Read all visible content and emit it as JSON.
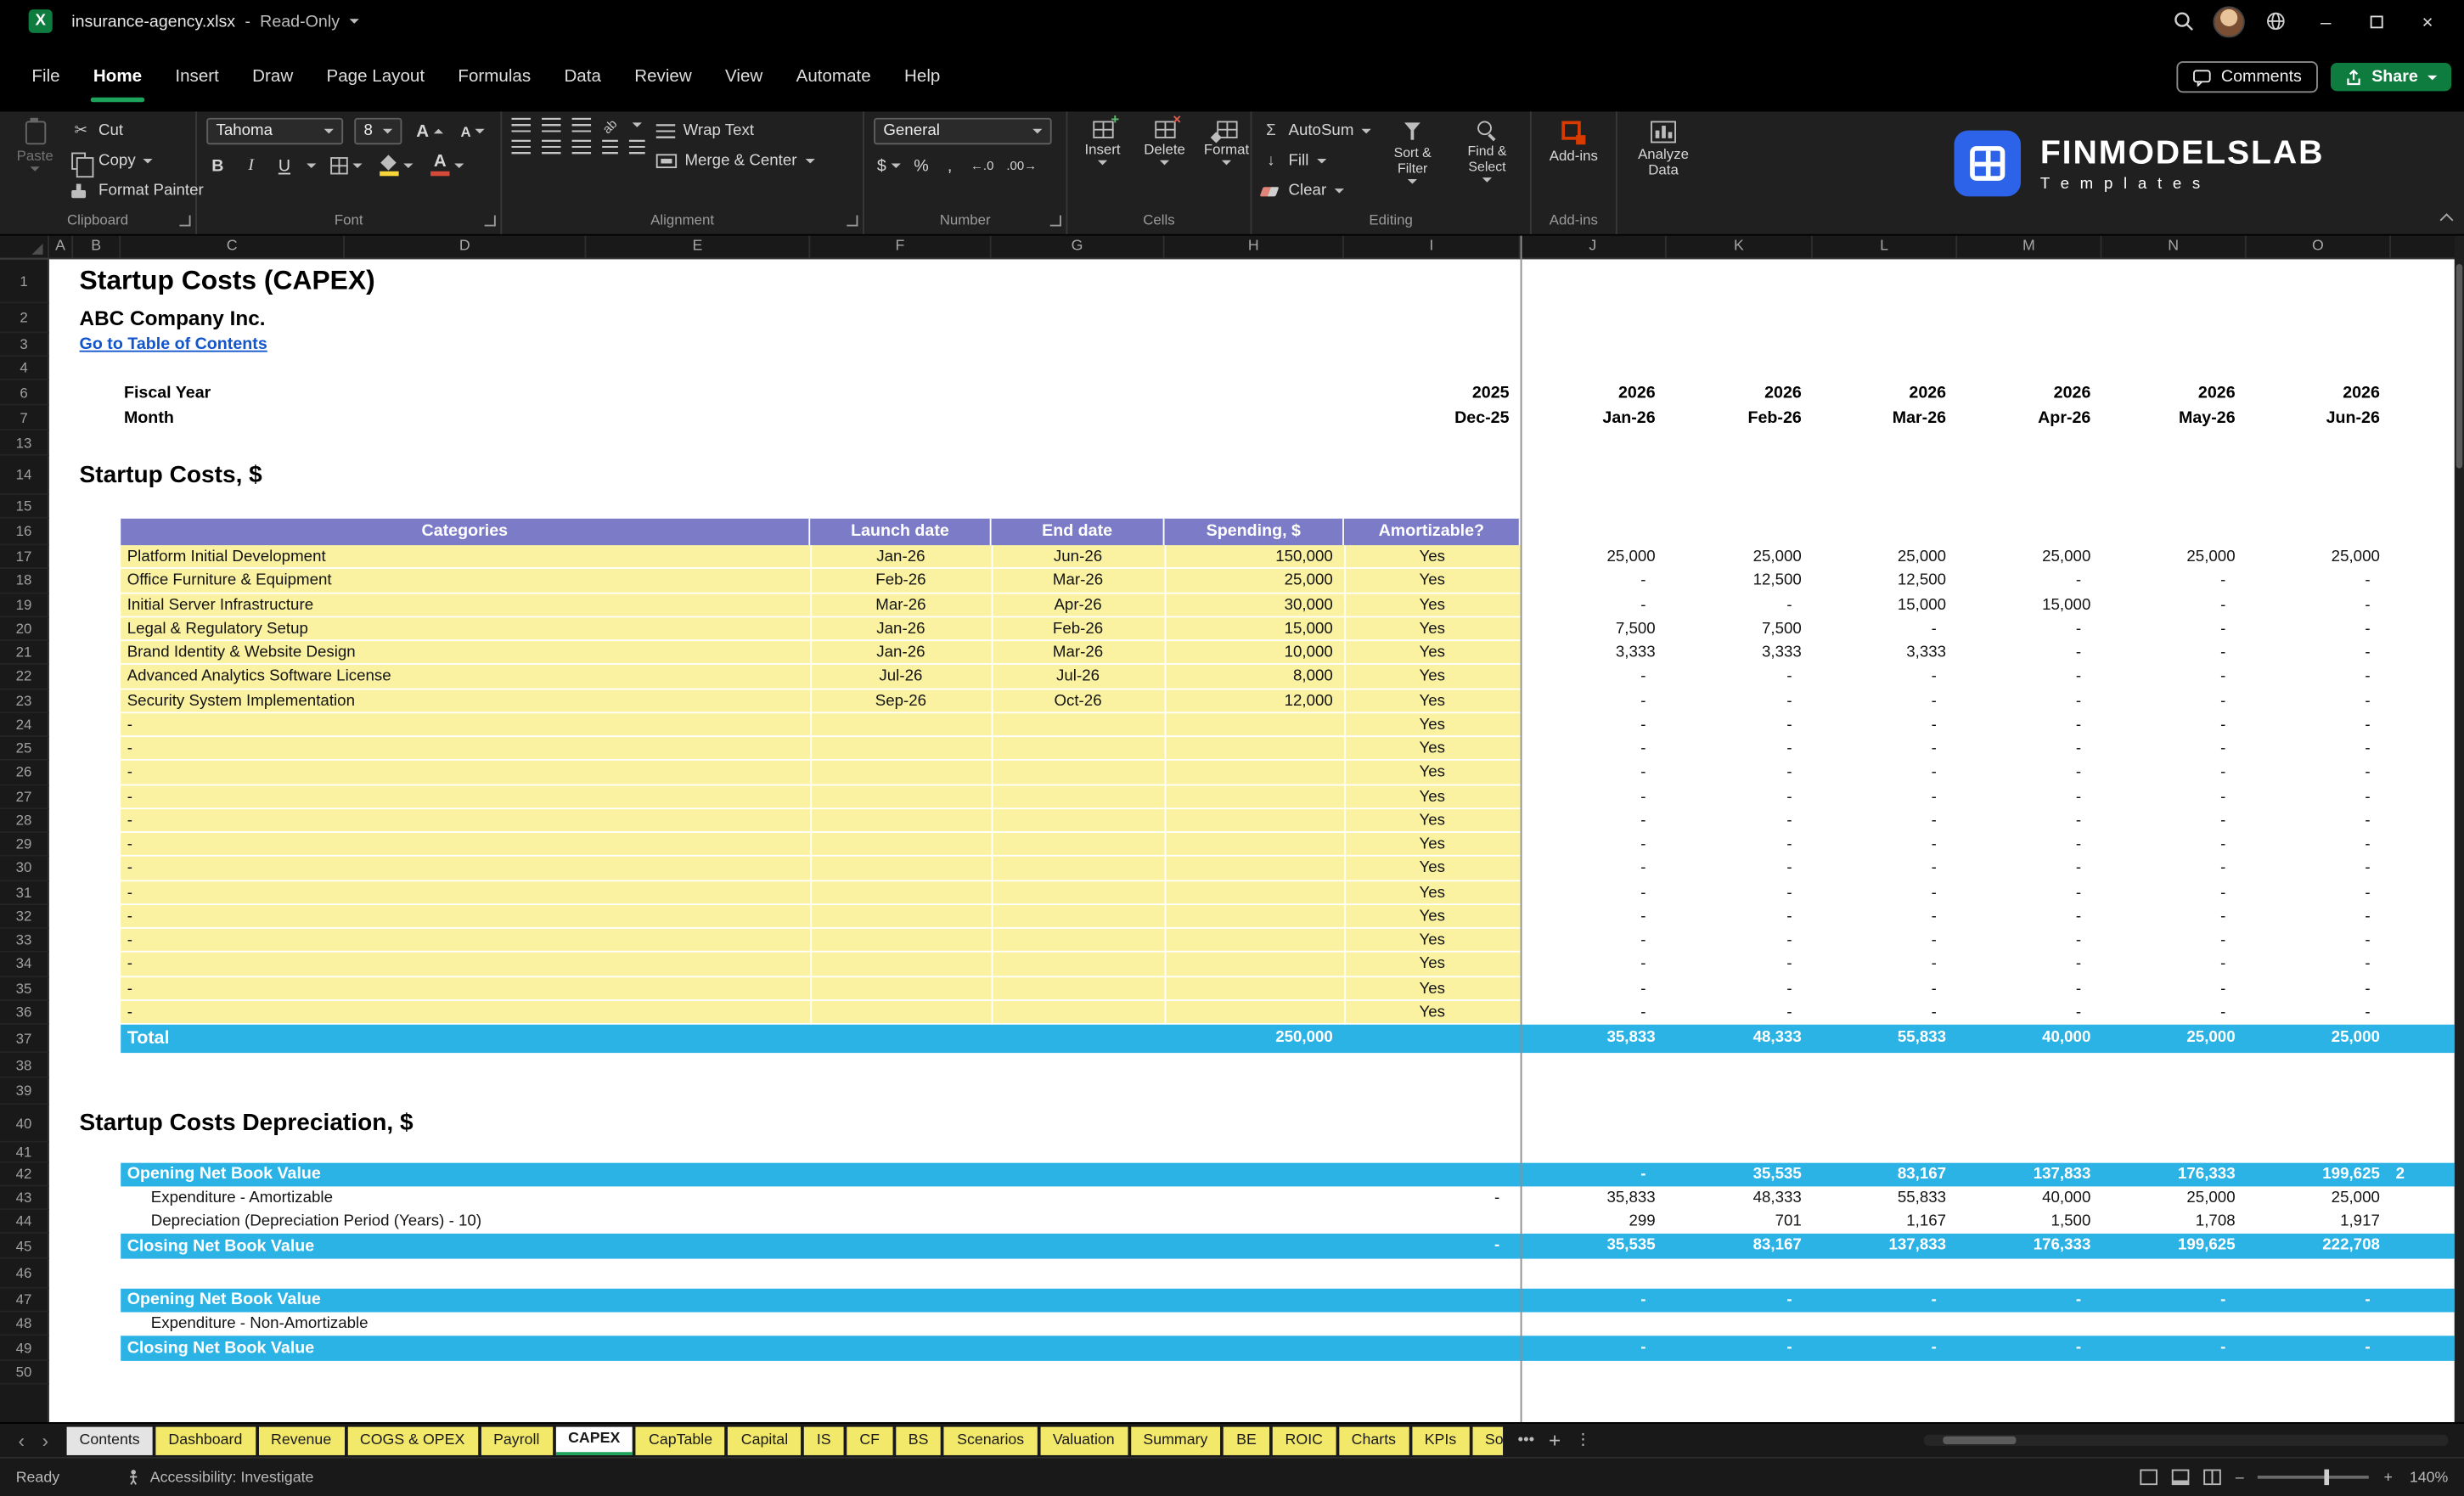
{
  "colors": {
    "accent-green": "#1EA35C",
    "share-green": "#0E7C3F",
    "cell-yellow": "#FAF2A0",
    "header-purple": "#7B7BC8",
    "band-cyan": "#2BB3E6",
    "link-blue": "#1155CC",
    "brand-blue": "#2C63E8",
    "tab-yellow": "#F2E96B"
  },
  "glyphs": {
    "excel_x": "X",
    "cut": "✂",
    "min": "–",
    "close": "×",
    "nav_prev": "‹",
    "nav_next": "›",
    "more_tabs": "•••",
    "add_tab": "+",
    "tab_menu": "⋮",
    "autosum": "Σ",
    "fill_arrow": "↓",
    "currency": "$",
    "percent": "%",
    "comma": ",",
    "inc_decimal": "←.0",
    "dec_decimal": ".00→",
    "bold": "B",
    "italic": "I",
    "underline": "U",
    "fontA": "A",
    "orientation": "ab"
  },
  "titlebar": {
    "filename": "insurance-agency.xlsx",
    "separator": "-",
    "mode": "Read-Only"
  },
  "menubar": {
    "items": [
      "File",
      "Home",
      "Insert",
      "Draw",
      "Page Layout",
      "Formulas",
      "Data",
      "Review",
      "View",
      "Automate",
      "Help"
    ],
    "active": "Home",
    "comments": "Comments",
    "share": "Share"
  },
  "ribbon": {
    "clipboard": {
      "group": "Clipboard",
      "paste": "Paste",
      "cut": "Cut",
      "copy": "Copy",
      "format_painter": "Format Painter"
    },
    "font": {
      "group": "Font",
      "name": "Tahoma",
      "size": "8"
    },
    "alignment": {
      "group": "Alignment",
      "wrap": "Wrap Text",
      "merge": "Merge & Center"
    },
    "number": {
      "group": "Number",
      "format": "General"
    },
    "cells": {
      "group": "Cells",
      "insert": "Insert",
      "delete": "Delete",
      "format": "Format"
    },
    "editing": {
      "group": "Editing",
      "autosum": "AutoSum",
      "fill": "Fill",
      "clear": "Clear",
      "sort": "Sort & Filter",
      "find": "Find & Select"
    },
    "addins": {
      "group": "Add-ins",
      "button": "Add-ins"
    },
    "analyze": {
      "button_line1": "Analyze",
      "button_line2": "Data"
    },
    "brand": {
      "name": "FINMODELSLAB",
      "tagline": "T e m p l a t e s"
    }
  },
  "sheet": {
    "columns": [
      "A",
      "B",
      "C",
      "D",
      "E",
      "F",
      "G",
      "H",
      "I",
      "J",
      "K",
      "L",
      "M",
      "N",
      "O"
    ],
    "row_numbers": [
      "1",
      "2",
      "3",
      "4",
      "6",
      "7",
      "13",
      "14",
      "15",
      "16",
      "17",
      "18",
      "19",
      "20",
      "21",
      "22",
      "23",
      "24",
      "25",
      "26",
      "27",
      "28",
      "29",
      "30",
      "31",
      "32",
      "33",
      "34",
      "35",
      "36",
      "37",
      "38",
      "39",
      "40",
      "41",
      "42",
      "43",
      "44",
      "45",
      "46",
      "47",
      "48",
      "49",
      "50"
    ],
    "title": "Startup Costs (CAPEX)",
    "company": "ABC Company Inc.",
    "toc_link": "Go to Table of Contents",
    "fiscal_year_label": "Fiscal Year",
    "month_label": "Month",
    "fiscal_year_first": "2025",
    "fiscal_years": [
      "2026",
      "2026",
      "2026",
      "2026",
      "2026",
      "2026"
    ],
    "month_first": "Dec-25",
    "months": [
      "Jan-26",
      "Feb-26",
      "Mar-26",
      "Apr-26",
      "May-26",
      "Jun-26"
    ],
    "section1": "Startup Costs, $",
    "table": {
      "headers": {
        "categories": "Categories",
        "launch": "Launch date",
        "end": "End date",
        "spending": "Spending, $",
        "amortizable": "Amortizable?"
      },
      "rows": [
        {
          "category": "Platform Initial Development",
          "launch": "Jan-26",
          "end": "Jun-26",
          "spending": "150,000",
          "amortizable": "Yes",
          "values": [
            "25,000",
            "25,000",
            "25,000",
            "25,000",
            "25,000",
            "25,000"
          ]
        },
        {
          "category": "Office Furniture & Equipment",
          "launch": "Feb-26",
          "end": "Mar-26",
          "spending": "25,000",
          "amortizable": "Yes",
          "values": [
            "-",
            "12,500",
            "12,500",
            "-",
            "-",
            "-"
          ]
        },
        {
          "category": "Initial Server Infrastructure",
          "launch": "Mar-26",
          "end": "Apr-26",
          "spending": "30,000",
          "amortizable": "Yes",
          "values": [
            "-",
            "-",
            "15,000",
            "15,000",
            "-",
            "-"
          ]
        },
        {
          "category": "Legal & Regulatory Setup",
          "launch": "Jan-26",
          "end": "Feb-26",
          "spending": "15,000",
          "amortizable": "Yes",
          "values": [
            "7,500",
            "7,500",
            "-",
            "-",
            "-",
            "-"
          ]
        },
        {
          "category": "Brand Identity & Website Design",
          "launch": "Jan-26",
          "end": "Mar-26",
          "spending": "10,000",
          "amortizable": "Yes",
          "values": [
            "3,333",
            "3,333",
            "3,333",
            "-",
            "-",
            "-"
          ]
        },
        {
          "category": "Advanced Analytics Software License",
          "launch": "Jul-26",
          "end": "Jul-26",
          "spending": "8,000",
          "amortizable": "Yes",
          "values": [
            "-",
            "-",
            "-",
            "-",
            "-",
            "-"
          ]
        },
        {
          "category": "Security System Implementation",
          "launch": "Sep-26",
          "end": "Oct-26",
          "spending": "12,000",
          "amortizable": "Yes",
          "values": [
            "-",
            "-",
            "-",
            "-",
            "-",
            "-"
          ]
        },
        {
          "category": "-",
          "launch": "",
          "end": "",
          "spending": "",
          "amortizable": "Yes",
          "values": [
            "-",
            "-",
            "-",
            "-",
            "-",
            "-"
          ]
        },
        {
          "category": "-",
          "launch": "",
          "end": "",
          "spending": "",
          "amortizable": "Yes",
          "values": [
            "-",
            "-",
            "-",
            "-",
            "-",
            "-"
          ]
        },
        {
          "category": "-",
          "launch": "",
          "end": "",
          "spending": "",
          "amortizable": "Yes",
          "values": [
            "-",
            "-",
            "-",
            "-",
            "-",
            "-"
          ]
        },
        {
          "category": "-",
          "launch": "",
          "end": "",
          "spending": "",
          "amortizable": "Yes",
          "values": [
            "-",
            "-",
            "-",
            "-",
            "-",
            "-"
          ]
        },
        {
          "category": "-",
          "launch": "",
          "end": "",
          "spending": "",
          "amortizable": "Yes",
          "values": [
            "-",
            "-",
            "-",
            "-",
            "-",
            "-"
          ]
        },
        {
          "category": "-",
          "launch": "",
          "end": "",
          "spending": "",
          "amortizable": "Yes",
          "values": [
            "-",
            "-",
            "-",
            "-",
            "-",
            "-"
          ]
        },
        {
          "category": "-",
          "launch": "",
          "end": "",
          "spending": "",
          "amortizable": "Yes",
          "values": [
            "-",
            "-",
            "-",
            "-",
            "-",
            "-"
          ]
        },
        {
          "category": "-",
          "launch": "",
          "end": "",
          "spending": "",
          "amortizable": "Yes",
          "values": [
            "-",
            "-",
            "-",
            "-",
            "-",
            "-"
          ]
        },
        {
          "category": "-",
          "launch": "",
          "end": "",
          "spending": "",
          "amortizable": "Yes",
          "values": [
            "-",
            "-",
            "-",
            "-",
            "-",
            "-"
          ]
        },
        {
          "category": "-",
          "launch": "",
          "end": "",
          "spending": "",
          "amortizable": "Yes",
          "values": [
            "-",
            "-",
            "-",
            "-",
            "-",
            "-"
          ]
        },
        {
          "category": "-",
          "launch": "",
          "end": "",
          "spending": "",
          "amortizable": "Yes",
          "values": [
            "-",
            "-",
            "-",
            "-",
            "-",
            "-"
          ]
        },
        {
          "category": "-",
          "launch": "",
          "end": "",
          "spending": "",
          "amortizable": "Yes",
          "values": [
            "-",
            "-",
            "-",
            "-",
            "-",
            "-"
          ]
        },
        {
          "category": "-",
          "launch": "",
          "end": "",
          "spending": "",
          "amortizable": "Yes",
          "values": [
            "-",
            "-",
            "-",
            "-",
            "-",
            "-"
          ]
        }
      ],
      "total": {
        "label": "Total",
        "spending": "250,000",
        "values": [
          "35,833",
          "48,333",
          "55,833",
          "40,000",
          "25,000",
          "25,000"
        ]
      }
    },
    "section2": "Startup Costs Depreciation, $",
    "depreciation_block1": [
      {
        "label": "Opening Net Book Value",
        "band": true,
        "first": "",
        "values": [
          "-",
          "35,535",
          "83,167",
          "137,833",
          "176,333",
          "199,625"
        ],
        "overflow": "2"
      },
      {
        "label": "Expenditure - Amortizable",
        "band": false,
        "first": "-",
        "values": [
          "35,833",
          "48,333",
          "55,833",
          "40,000",
          "25,000",
          "25,000"
        ]
      },
      {
        "label": "Depreciation (Depreciation Period (Years) - 10)",
        "band": false,
        "first": "",
        "values": [
          "299",
          "701",
          "1,167",
          "1,500",
          "1,708",
          "1,917"
        ]
      },
      {
        "label": "Closing Net Book Value",
        "band": true,
        "first": "-",
        "values": [
          "35,535",
          "83,167",
          "137,833",
          "176,333",
          "199,625",
          "222,708"
        ]
      }
    ],
    "depreciation_block2": [
      {
        "label": "Opening Net Book Value",
        "band": true,
        "first": "",
        "values": [
          "-",
          "-",
          "-",
          "-",
          "-",
          "-"
        ]
      },
      {
        "label": "Expenditure - Non-Amortizable",
        "band": false,
        "first": "",
        "values": [
          "",
          "",
          "",
          "",
          "",
          ""
        ]
      },
      {
        "label": "Closing Net Book Value",
        "band": true,
        "first": "",
        "values": [
          "-",
          "-",
          "-",
          "-",
          "-",
          "-"
        ]
      }
    ]
  },
  "tabs": {
    "items": [
      {
        "label": "Contents",
        "color": "gray"
      },
      {
        "label": "Dashboard",
        "color": "yellow"
      },
      {
        "label": "Revenue",
        "color": "yellow"
      },
      {
        "label": "COGS & OPEX",
        "color": "yellow"
      },
      {
        "label": "Payroll",
        "color": "yellow"
      },
      {
        "label": "CAPEX",
        "color": "active"
      },
      {
        "label": "CapTable",
        "color": "yellow"
      },
      {
        "label": "Capital",
        "color": "yellow"
      },
      {
        "label": "IS",
        "color": "yellow"
      },
      {
        "label": "CF",
        "color": "yellow"
      },
      {
        "label": "BS",
        "color": "yellow"
      },
      {
        "label": "Scenarios",
        "color": "yellow"
      },
      {
        "label": "Valuation",
        "color": "yellow"
      },
      {
        "label": "Summary",
        "color": "yellow"
      },
      {
        "label": "BE",
        "color": "yellow"
      },
      {
        "label": "ROIC",
        "color": "yellow"
      },
      {
        "label": "Charts",
        "color": "yellow"
      },
      {
        "label": "KPIs",
        "color": "yellow"
      },
      {
        "label": "So",
        "color": "yellow",
        "clipped": true
      }
    ]
  },
  "statusbar": {
    "ready": "Ready",
    "accessibility": "Accessibility: Investigate",
    "zoom": "140%"
  }
}
